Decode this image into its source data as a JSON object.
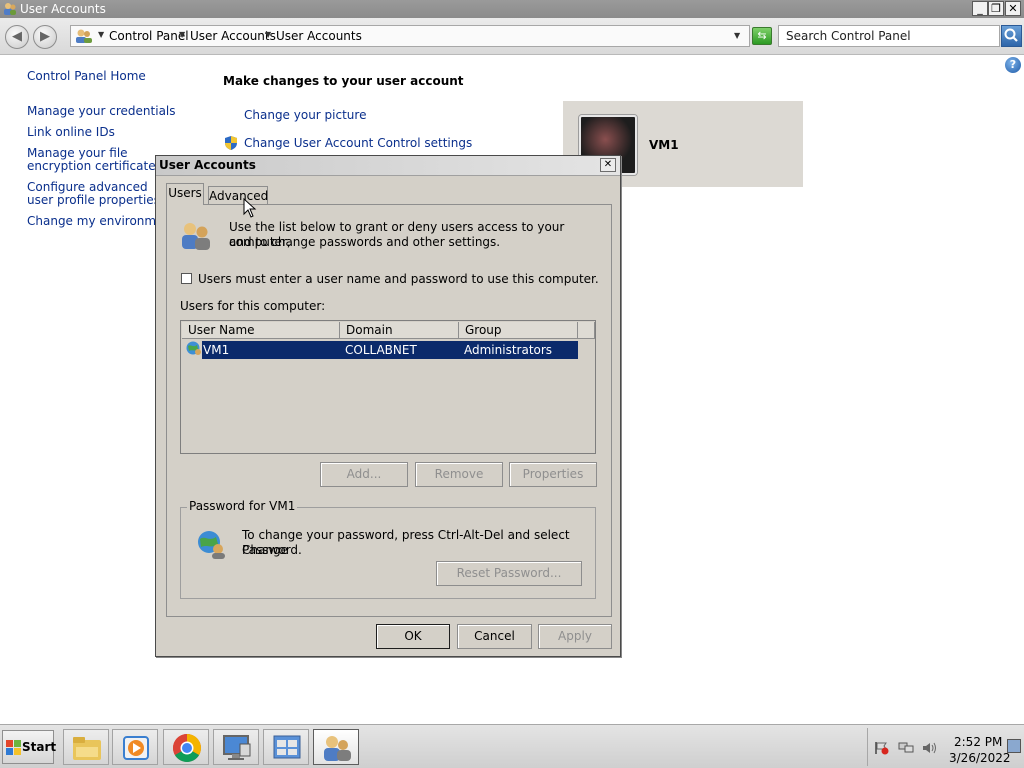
{
  "window": {
    "title": "User Accounts",
    "controls": {
      "minimize": "_",
      "maximize": "❐",
      "close": "✕"
    }
  },
  "address_bar": {
    "back_icon": "back-arrow-icon",
    "forward_icon": "forward-arrow-icon",
    "breadcrumbs": [
      "Control Panel",
      "User Accounts",
      "User Accounts"
    ],
    "search_placeholder": "Search Control Panel"
  },
  "sidebar": {
    "home": "Control Panel Home",
    "items": [
      {
        "label": "Manage your credentials"
      },
      {
        "label": "Link online IDs"
      },
      {
        "label": "Manage your file encryption certificates"
      },
      {
        "label": "Configure advanced user profile properties"
      },
      {
        "label": "Change my environment v"
      }
    ]
  },
  "main": {
    "heading": "Make changes to your user account",
    "links": [
      {
        "label": "Change your picture"
      },
      {
        "label": "Change User Account Control settings"
      }
    ],
    "user_panel": {
      "name": "VM1"
    }
  },
  "dialog": {
    "title": "User Accounts",
    "tabs": [
      {
        "label": "Users",
        "active": true
      },
      {
        "label": "Advanced",
        "active": false
      }
    ],
    "intro_line1": "Use the list below to grant or deny users access to your computer,",
    "intro_line2": "and to change passwords and other settings.",
    "checkbox_label": "Users must enter a user name and password to use this computer.",
    "checkbox_checked": false,
    "list_label": "Users for this computer:",
    "columns": [
      "User Name",
      "Domain",
      "Group"
    ],
    "rows": [
      {
        "user": "VM1",
        "domain": "COLLABNET",
        "group": "Administrators",
        "selected": true
      }
    ],
    "buttons": {
      "add": "Add...",
      "remove": "Remove",
      "properties": "Properties"
    },
    "password_group": {
      "legend": "Password for VM1",
      "text_line1": "To change your password, press Ctrl-Alt-Del and select Change",
      "text_line2": "Password.",
      "reset_button": "Reset Password..."
    },
    "footer": {
      "ok": "OK",
      "cancel": "Cancel",
      "apply": "Apply"
    }
  },
  "taskbar": {
    "start_label": "Start",
    "apps": [
      "file-explorer-icon",
      "media-player-icon",
      "chrome-icon",
      "remote-desktop-icon",
      "control-panel-icon",
      "user-accounts-icon"
    ],
    "clock_time": "2:52 PM",
    "clock_date": "3/26/2022"
  },
  "colors": {
    "selection": "#0b2a6b",
    "link": "#0a2f8c",
    "dialog_face": "#d4d0c8"
  }
}
